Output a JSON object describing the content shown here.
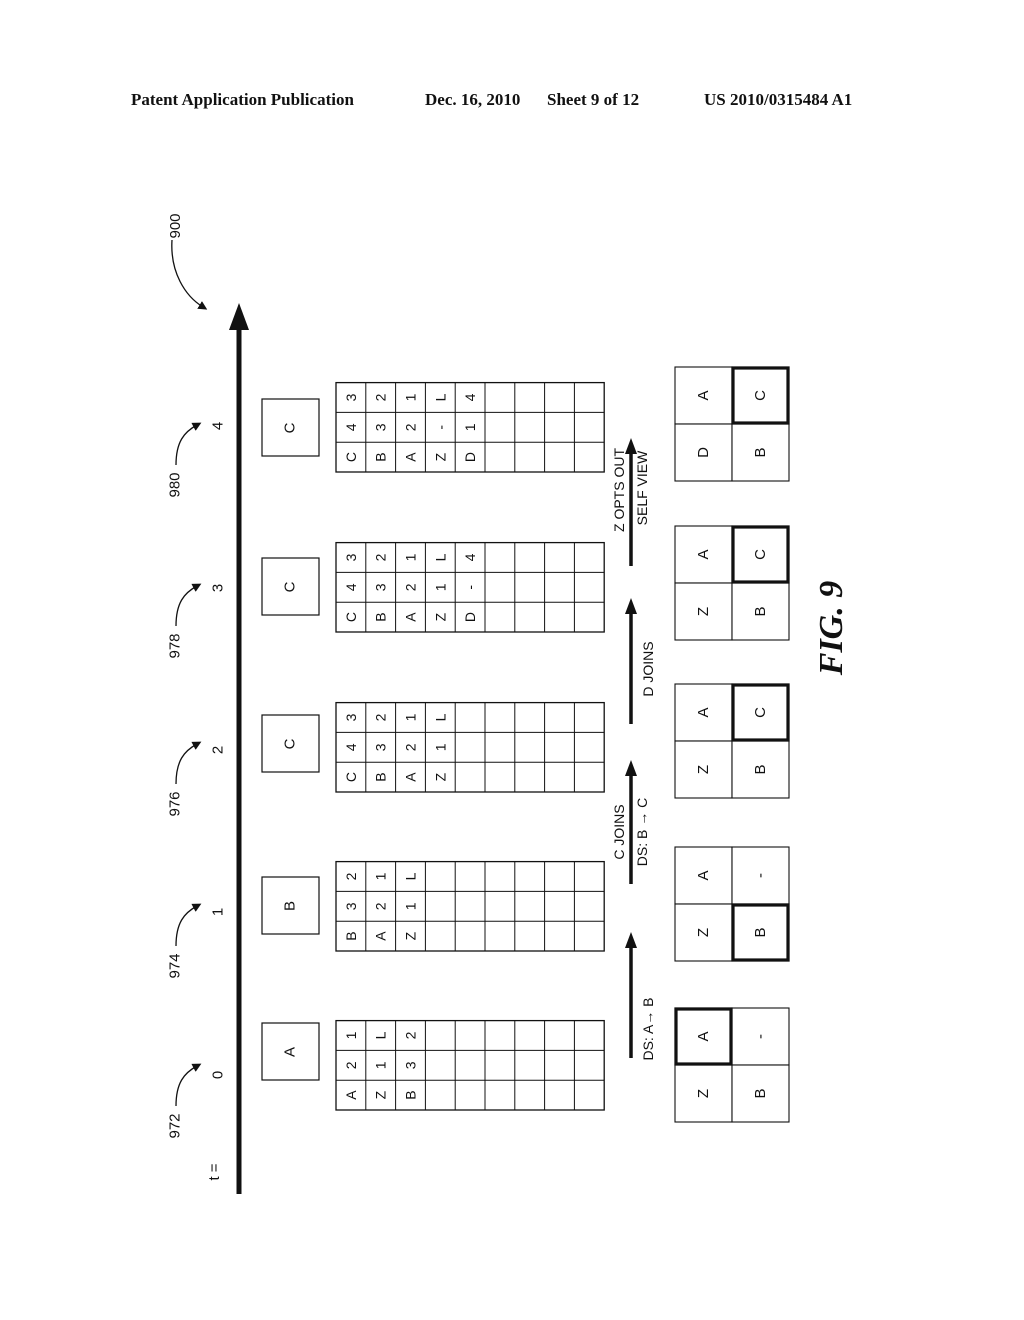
{
  "header": {
    "left": "Patent Application Publication",
    "date": "Dec. 16, 2010",
    "sheet": "Sheet 9 of 12",
    "pub_number": "US 2010/0315484 A1"
  },
  "figure": {
    "label": "FIG. 9",
    "ref": "900",
    "time_prefix": "t =",
    "time_steps": [
      {
        "t": "0",
        "ref": "972",
        "speaker": "A",
        "table": [
          [
            "A",
            "2",
            "1"
          ],
          [
            "Z",
            "1",
            "L"
          ],
          [
            "B",
            "3",
            "2"
          ]
        ],
        "grid": [
          [
            "A",
            "-"
          ],
          [
            "Z",
            "B"
          ]
        ],
        "grid_bold": [
          0,
          0
        ],
        "transition": [
          "DS: A→ B"
        ]
      },
      {
        "t": "1",
        "ref": "974",
        "speaker": "B",
        "table": [
          [
            "B",
            "3",
            "2"
          ],
          [
            "A",
            "2",
            "1"
          ],
          [
            "Z",
            "1",
            "L"
          ]
        ],
        "grid": [
          [
            "A",
            "-"
          ],
          [
            "Z",
            "B"
          ]
        ],
        "grid_bold": [
          1,
          1
        ],
        "transition": [
          "C JOINS",
          "DS: B → C"
        ]
      },
      {
        "t": "2",
        "ref": "976",
        "speaker": "C",
        "table": [
          [
            "C",
            "4",
            "3"
          ],
          [
            "B",
            "3",
            "2"
          ],
          [
            "A",
            "2",
            "1"
          ],
          [
            "Z",
            "1",
            "L"
          ]
        ],
        "grid": [
          [
            "A",
            "C"
          ],
          [
            "Z",
            "B"
          ]
        ],
        "grid_bold": [
          0,
          1
        ],
        "transition": [
          "D JOINS"
        ]
      },
      {
        "t": "3",
        "ref": "978",
        "speaker": "C",
        "table": [
          [
            "C",
            "4",
            "3"
          ],
          [
            "B",
            "3",
            "2"
          ],
          [
            "A",
            "2",
            "1"
          ],
          [
            "Z",
            "1",
            "L"
          ],
          [
            "D",
            "-",
            "4"
          ]
        ],
        "grid": [
          [
            "A",
            "C"
          ],
          [
            "Z",
            "B"
          ]
        ],
        "grid_bold": [
          0,
          1
        ],
        "transition": [
          "Z OPTS OUT",
          "SELF VIEW"
        ]
      },
      {
        "t": "4",
        "ref": "980",
        "speaker": "C",
        "table": [
          [
            "C",
            "4",
            "3"
          ],
          [
            "B",
            "3",
            "2"
          ],
          [
            "A",
            "2",
            "1"
          ],
          [
            "Z",
            "-",
            "L"
          ],
          [
            "D",
            "1",
            "4"
          ]
        ],
        "grid": [
          [
            "A",
            "C"
          ],
          [
            "D",
            "B"
          ]
        ],
        "grid_bold": [
          0,
          1
        ],
        "transition": []
      }
    ]
  }
}
